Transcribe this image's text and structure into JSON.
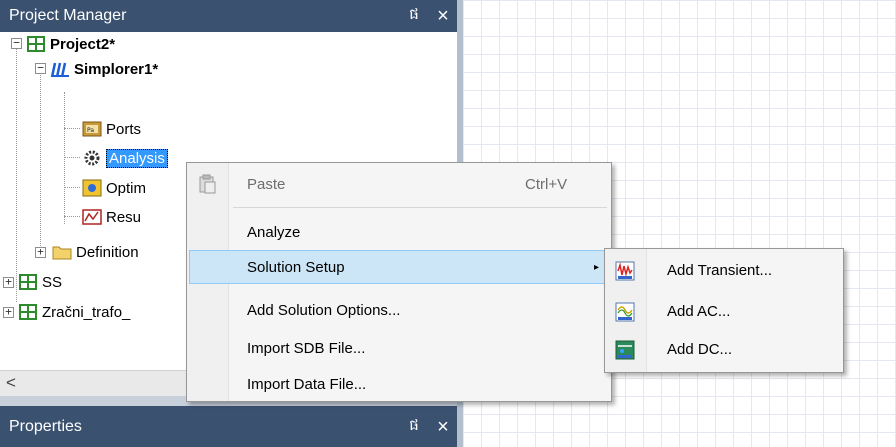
{
  "project_manager": {
    "title": "Project Manager",
    "pin_glyph": "ផ",
    "close_glyph": "×"
  },
  "tree": {
    "project": "Project2*",
    "design": "Simplorer1*",
    "children": [
      "Ports",
      "Analysis",
      "Optim",
      "Resu"
    ],
    "definitions": "Definition",
    "ss": "SS",
    "trafo": "Zračni_trafo_"
  },
  "scrollbar": {
    "left_arrow": "<"
  },
  "properties": {
    "title": "Properties",
    "pin_glyph": "ផ",
    "close_glyph": "×"
  },
  "context_menu": {
    "paste": "Paste",
    "paste_shortcut": "Ctrl+V",
    "analyze": "Analyze",
    "solution_setup": "Solution Setup",
    "submenu_arrow": "▸",
    "add_solution_options": "Add Solution Options...",
    "import_sdb": "Import SDB File...",
    "import_data": "Import Data File..."
  },
  "submenu": {
    "add_transient": "Add Transient...",
    "add_ac": "Add AC...",
    "add_dc": "Add DC..."
  },
  "colors": {
    "titlebar": "#3b5170",
    "menu_hover": "#cde6f7",
    "selection": "#3399ff"
  }
}
